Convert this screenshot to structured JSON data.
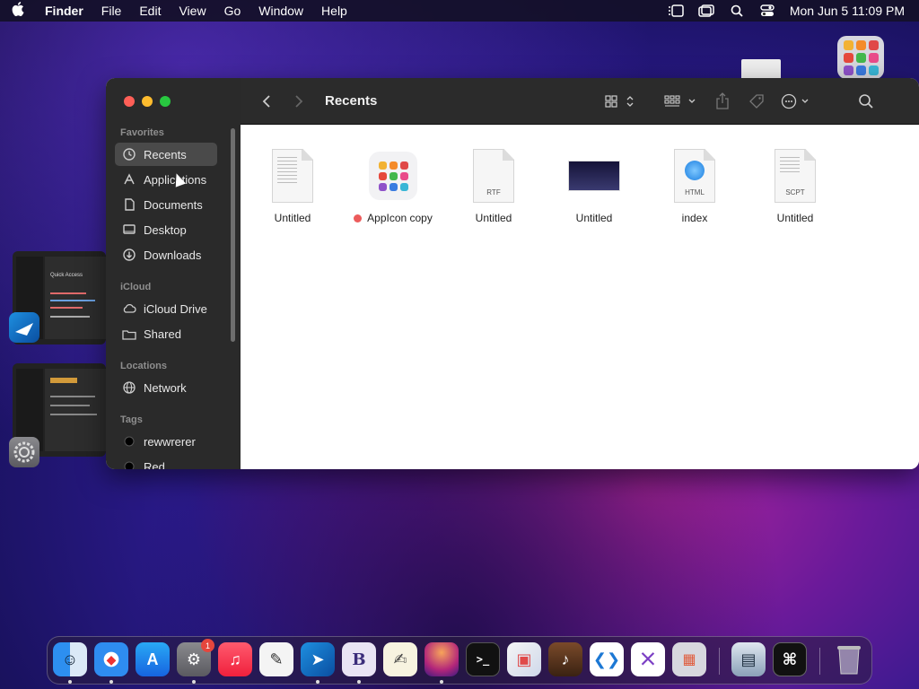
{
  "menubar": {
    "app_name": "Finder",
    "items": [
      "File",
      "Edit",
      "View",
      "Go",
      "Window",
      "Help"
    ],
    "clock": "Mon Jun 5  11:09 PM"
  },
  "window": {
    "title": "Recents",
    "sidebar": {
      "favorites_header": "Favorites",
      "favorites": [
        "Recents",
        "Applications",
        "Documents",
        "Desktop",
        "Downloads"
      ],
      "icloud_header": "iCloud",
      "icloud": [
        "iCloud Drive",
        "Shared"
      ],
      "locations_header": "Locations",
      "locations": [
        "Network"
      ],
      "tags_header": "Tags",
      "tags": [
        "rewwrerer",
        "Red"
      ]
    },
    "files": [
      {
        "name": "Untitled",
        "kind": "text-doc",
        "label": ""
      },
      {
        "name": "AppIcon copy",
        "kind": "app-icon",
        "label": ""
      },
      {
        "name": "Untitled",
        "kind": "doc",
        "label": "RTF"
      },
      {
        "name": "Untitled",
        "kind": "image",
        "label": ""
      },
      {
        "name": "index",
        "kind": "html-doc",
        "label": "HTML"
      },
      {
        "name": "Untitled",
        "kind": "doc",
        "label": "SCPT"
      }
    ]
  },
  "stage": {
    "thumb1_title": "Quick Access"
  },
  "dock": {
    "settings_badge": "1"
  },
  "colors": {
    "close": "#ff5f57",
    "minimize": "#febc2e",
    "zoom": "#28c840",
    "tag_red": "#ec5b5b"
  }
}
